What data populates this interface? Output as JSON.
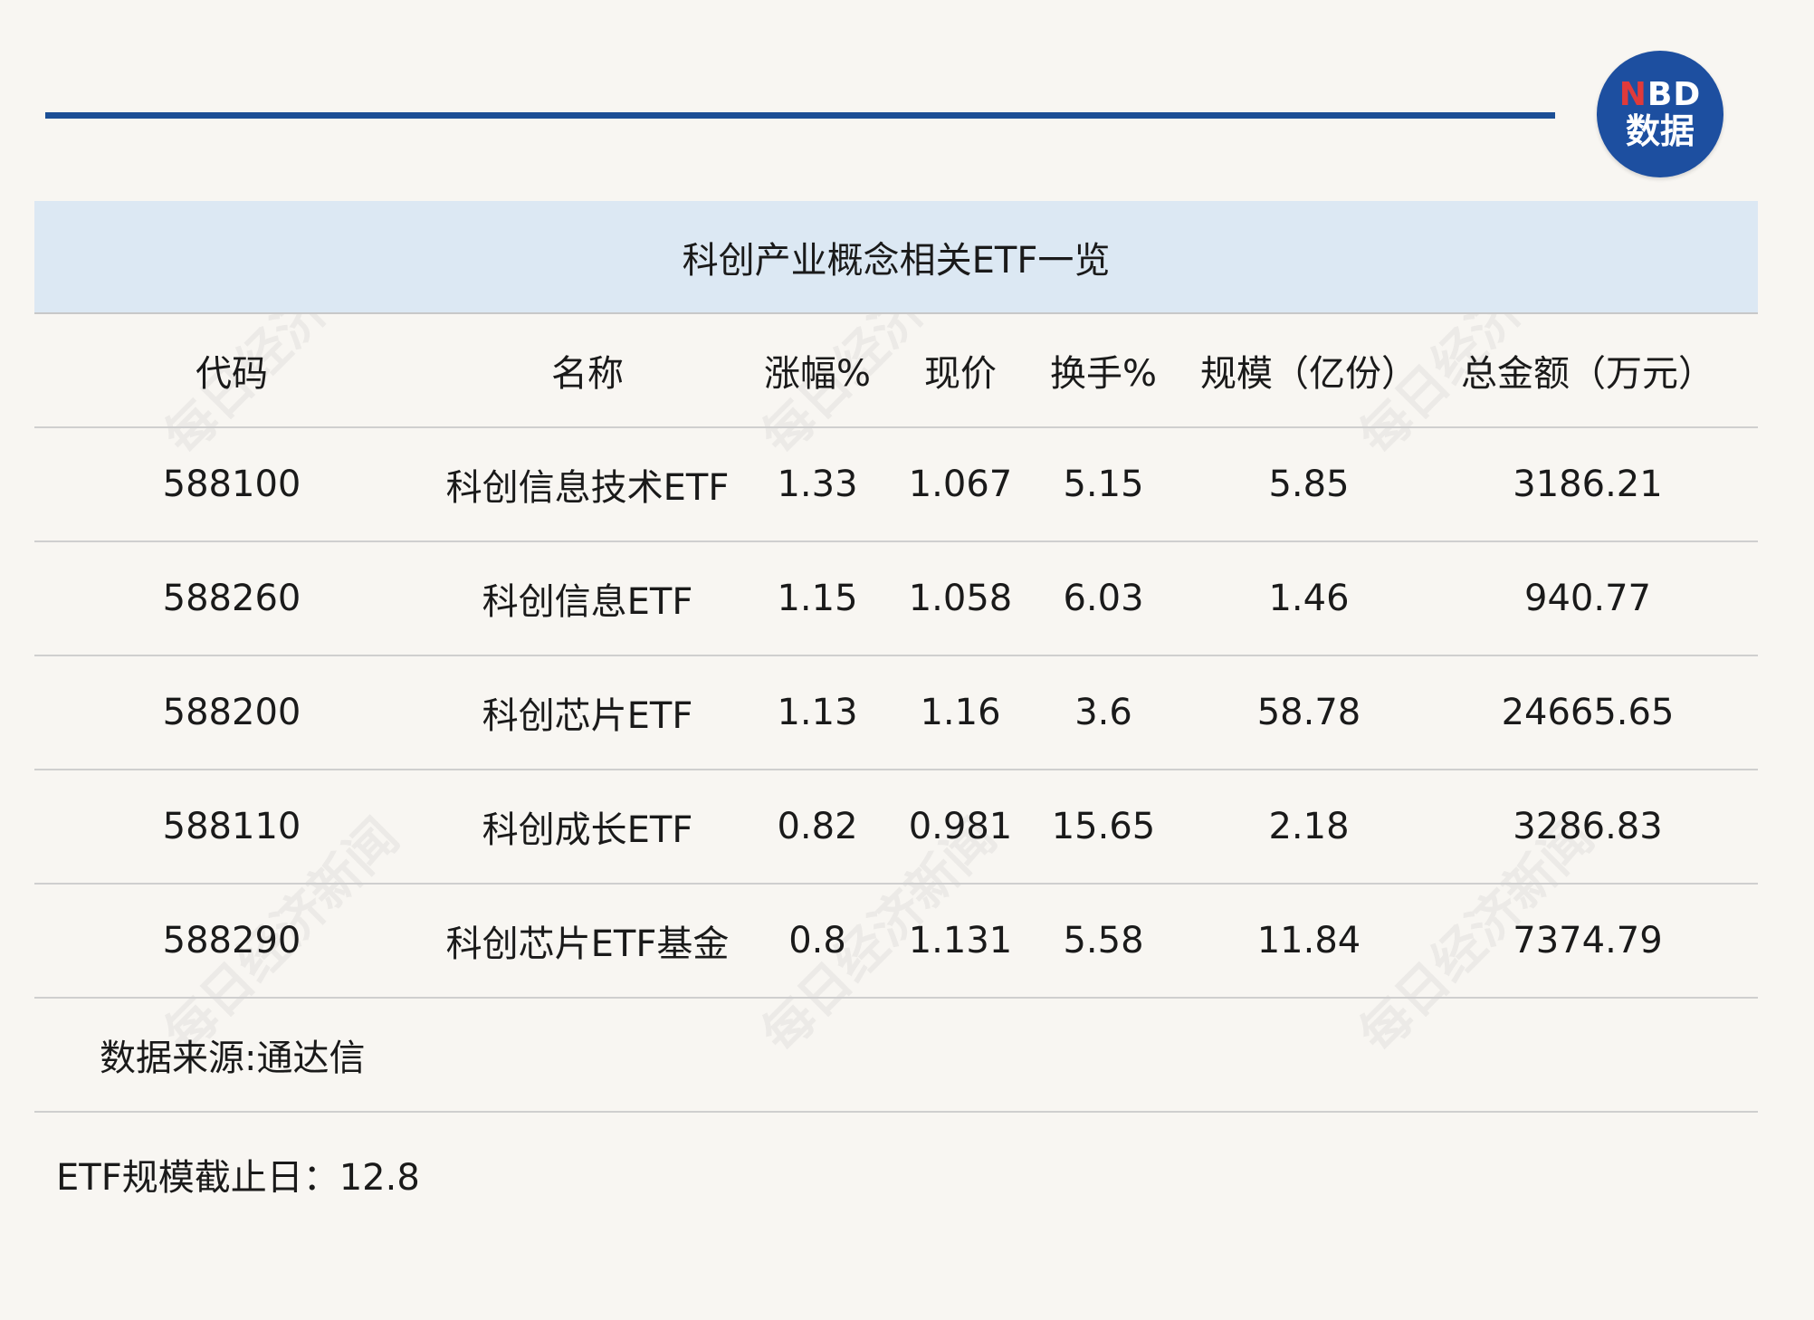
{
  "logo": {
    "line1_n": "N",
    "line1_rest": "BD",
    "line2": "数据"
  },
  "watermark": "每日经济新闻",
  "table": {
    "title": "科创产业概念相关ETF一览",
    "headers": [
      "代码",
      "名称",
      "涨幅%",
      "现价",
      "换手%",
      "规模（亿份）",
      "总金额（万元）"
    ],
    "rows": [
      [
        "588100",
        "科创信息技术ETF",
        "1.33",
        "1.067",
        "5.15",
        "5.85",
        "3186.21"
      ],
      [
        "588260",
        "科创信息ETF",
        "1.15",
        "1.058",
        "6.03",
        "1.46",
        "940.77"
      ],
      [
        "588200",
        "科创芯片ETF",
        "1.13",
        "1.16",
        "3.6",
        "58.78",
        "24665.65"
      ],
      [
        "588110",
        "科创成长ETF",
        "0.82",
        "0.981",
        "15.65",
        "2.18",
        "3286.83"
      ],
      [
        "588290",
        "科创芯片ETF基金",
        "0.8",
        "1.131",
        "5.58",
        "11.84",
        "7374.79"
      ]
    ],
    "source": "数据来源:通达信"
  },
  "note": "ETF规模截止日：12.8",
  "colors": {
    "rule": "#1c4f96",
    "caption_bg": "#dce8f3",
    "logo_bg": "#1d4fa0",
    "logo_accent": "#e03a3a"
  }
}
